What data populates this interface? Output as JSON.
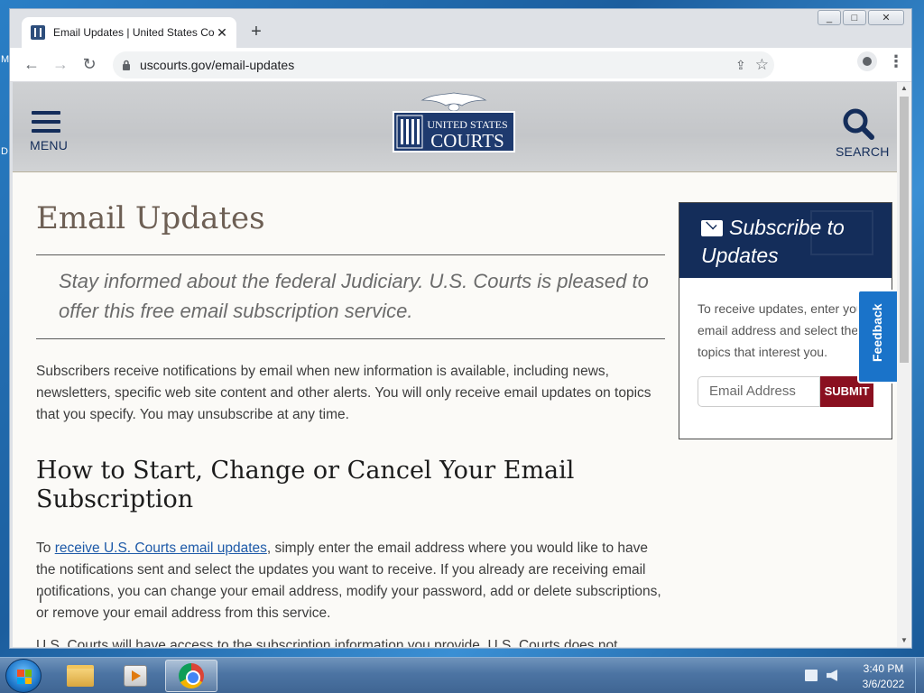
{
  "desktop": {
    "edge_letters": [
      "M",
      "D"
    ]
  },
  "window": {
    "controls": [
      "_",
      "□",
      "✕"
    ]
  },
  "tab": {
    "title": "Email Updates | United States Co",
    "close": "✕"
  },
  "new_tab": "+",
  "toolbar": {
    "back": "←",
    "forward": "→",
    "reload": "↻",
    "url": "uscourts.gov/email-updates",
    "share": "⇪",
    "star": "☆",
    "menu": "⋮"
  },
  "header": {
    "menu_label": "MENU",
    "search_label": "SEARCH",
    "logo_line1": "UNITED STATES",
    "logo_line2": "COURTS"
  },
  "main": {
    "title": "Email Updates",
    "intro": "Stay informed about the federal Judiciary. U.S. Courts is pleased to offer this free email subscription service.",
    "para1": "Subscribers receive notifications by email when new information is available, including news, newsletters, specific web site content and other alerts. You will only receive email updates on topics that you specify. You may unsubscribe at any time.",
    "h2": "How to Start, Change or Cancel Your Email Subscription",
    "para2_before": "To ",
    "para2_link": "receive U.S. Courts email updates",
    "para2_after": ", simply enter the email address where you would like to have the notifications sent and select the updates you want to receive. If you already are receiving email notifications, you can change your email address, modify your password, add or delete subscriptions, or remove your email address from this service.",
    "para3_partial": "U.S. Courts will have access to the subscription information you provide. U.S. Courts does not"
  },
  "sidebar": {
    "title": "Subscribe to Updates",
    "text": "To receive updates, enter your email address and select the topics that interest you.",
    "email_placeholder": "Email Address",
    "submit": "SUBMIT"
  },
  "feedback": {
    "label": "Feedback"
  },
  "taskbar": {
    "time": "3:40 PM",
    "date": "3/6/2022"
  }
}
